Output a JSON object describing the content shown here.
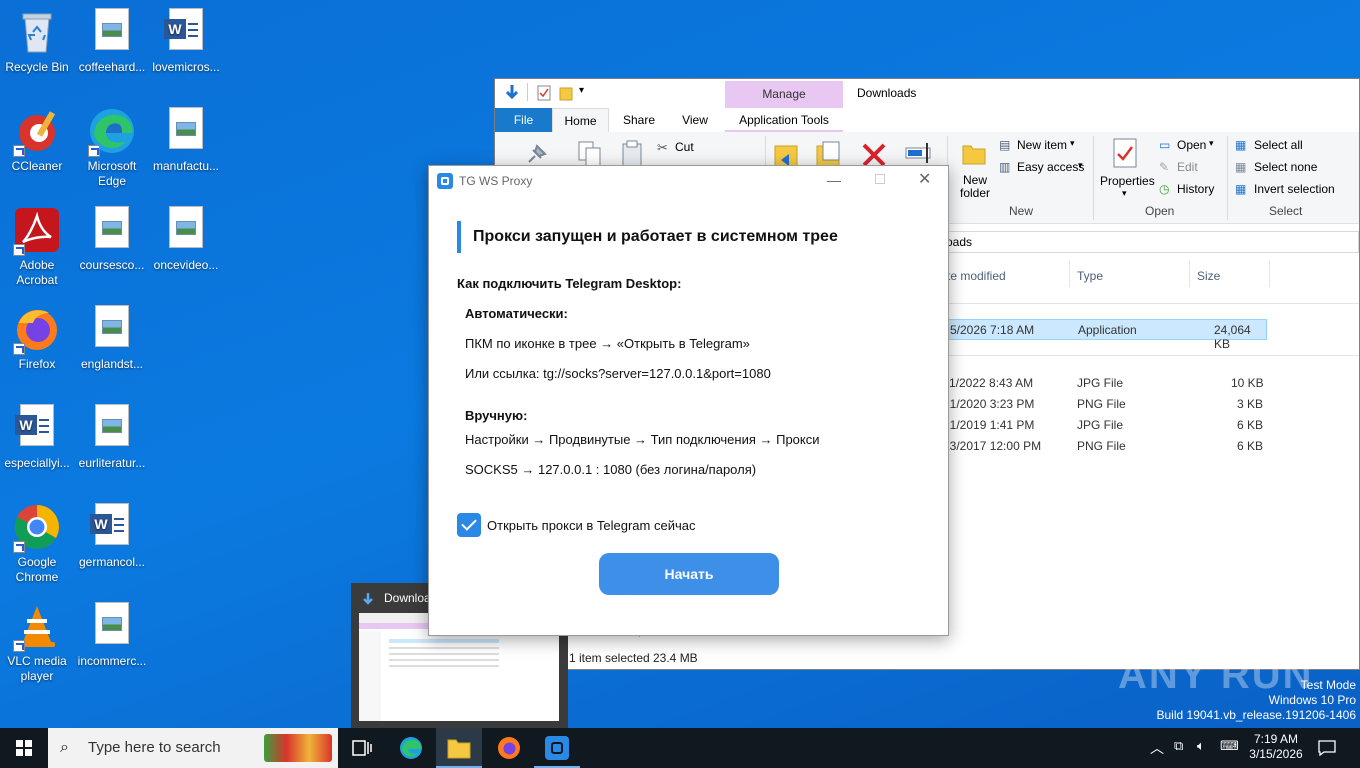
{
  "desktop": {
    "icons": [
      {
        "label": "Recycle Bin"
      },
      {
        "label": "coffeehard..."
      },
      {
        "label": "lovemicros..."
      },
      {
        "label": "CCleaner"
      },
      {
        "label": "Microsoft Edge"
      },
      {
        "label": "manufactu..."
      },
      {
        "label": "Adobe Acrobat"
      },
      {
        "label": "coursesco..."
      },
      {
        "label": "oncevideo..."
      },
      {
        "label": "Firefox"
      },
      {
        "label": "englandst..."
      },
      {
        "label": "especiallyi..."
      },
      {
        "label": "eurliteratur..."
      },
      {
        "label": "Google Chrome"
      },
      {
        "label": "germancol..."
      },
      {
        "label": "VLC media player"
      },
      {
        "label": "incommerc..."
      }
    ]
  },
  "explorer": {
    "title": "Downloads",
    "manage_label": "Manage",
    "tabs": [
      "File",
      "Home",
      "Share",
      "View",
      "Application Tools"
    ],
    "ribbon": {
      "cut": "Cut",
      "new_item": "New item",
      "easy_access": "Easy access",
      "new_folder": "New folder",
      "new_group": "New",
      "properties": "Properties",
      "open": "Open",
      "edit": "Edit",
      "history": "History",
      "open_group": "Open",
      "select_all": "Select all",
      "select_none": "Select none",
      "invert_selection": "Invert selection",
      "select_group": "Select"
    },
    "breadcrumb_fragment": "oads",
    "columns": [
      "te modified",
      "Type",
      "Size"
    ],
    "rows": [
      {
        "date": "5/2026 7:18 AM",
        "type": "Application",
        "size": "24,064 KB"
      },
      {
        "date": "1/2022 8:43 AM",
        "type": "JPG File",
        "size": "10 KB"
      },
      {
        "date": "21/2020 3:23 PM",
        "type": "PNG File",
        "size": "3 KB"
      },
      {
        "date": "21/2019 1:41 PM",
        "type": "JPG File",
        "size": "6 KB"
      },
      {
        "date": "23/2017 12:00 PM",
        "type": "PNG File",
        "size": "6 KB"
      }
    ],
    "status_selected": "1 item selected",
    "status_size": "23.4 MB"
  },
  "dialog": {
    "title": "TG WS Proxy",
    "heading": "Прокси запущен и работает в системном трее",
    "how_to": "Как подключить Telegram Desktop:",
    "auto_label": "Автоматически:",
    "auto_line1": "ПКМ по иконке в трее → «Открыть в Telegram»",
    "auto_line2": "Или ссылка: tg://socks?server=127.0.0.1&port=1080",
    "manual_label": "Вручную:",
    "manual_line1": "Настройки → Продвинутые → Тип подключения → Прокси",
    "manual_line2": "SOCKS5 → 127.0.0.1 : 1080 (без логина/пароля)",
    "checkbox_label": "Открыть прокси в Telegram сейчас",
    "checkbox_checked": true,
    "start_button": "Начать"
  },
  "taskbar_preview": {
    "title": "Downloa"
  },
  "taskbar": {
    "search_placeholder": "Type here to search",
    "time": "7:19 AM",
    "date": "3/15/2026"
  },
  "watermark": {
    "brand": "ANY RUN",
    "line1": "Test Mode",
    "line2": "Windows 10 Pro",
    "line3": "Build 19041.vb_release.191206-1406"
  },
  "colors": {
    "accent": "#2b89e6",
    "button": "#3d8fe8",
    "taskbar": "#101820",
    "desktop": "#0b7ae0",
    "selection": "#cce8ff"
  }
}
